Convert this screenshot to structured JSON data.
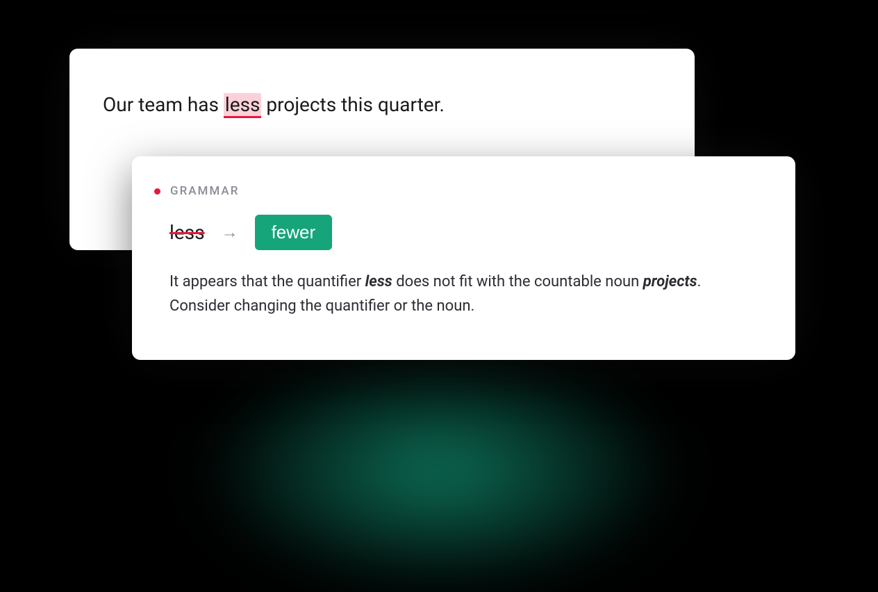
{
  "colors": {
    "error": "#e6183d",
    "highlight_bg": "#fbd1d9",
    "suggestion_bg": "#16a47a"
  },
  "editor": {
    "sentence_prefix": "Our team has ",
    "highlighted_word": "less",
    "sentence_suffix": " projects this quarter."
  },
  "suggestion": {
    "category": "GRAMMAR",
    "original_word": "less",
    "arrow": "→",
    "replacement_word": "fewer",
    "explanation_part1": "It appears that the quantifier ",
    "explanation_bold1": "less",
    "explanation_part2": " does not fit with the countable noun ",
    "explanation_bold2": "projects",
    "explanation_part3": ". Consider changing the quantifier or the noun."
  }
}
